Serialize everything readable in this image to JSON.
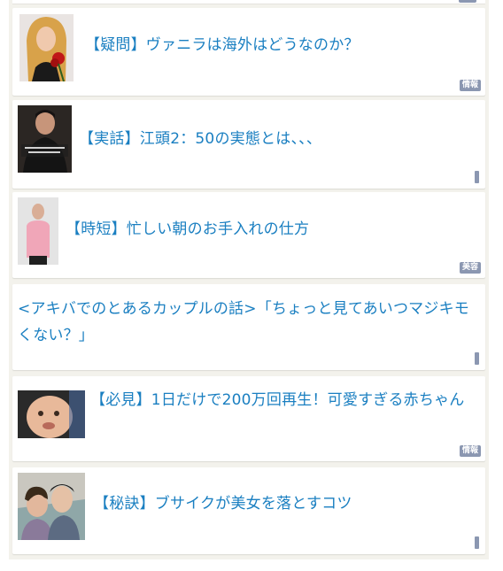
{
  "items": [
    {
      "title": "【疑問】ヴァニラは海外はどうなのか？",
      "tag": "情報",
      "thumb": "thumbnail-blonde-woman-red-rose"
    },
    {
      "title": "【実話】江頭2：50の実態とは、、、",
      "thumb": "thumbnail-man-in-black-with-caption"
    },
    {
      "title": "【時短】忙しい朝のお手入れの仕方",
      "tag": "美容",
      "thumb": "thumbnail-man-pink-shirt"
    },
    {
      "title": "<アキバでのとあるカップルの話>「ちょっと見てあいつマジキモくない？」"
    },
    {
      "title": "【必見】1日だけで200万回再生！可愛すぎる赤ちゃん",
      "tag": "情報",
      "thumb": "thumbnail-baby"
    },
    {
      "title": "【秘訣】ブサイクが美女を落とすコツ",
      "thumb": "thumbnail-couple-selfie"
    }
  ],
  "colors": {
    "link": "#1a7fc1",
    "tag_bg": "#8b97b1",
    "feed_bg": "#f3f2ec"
  }
}
